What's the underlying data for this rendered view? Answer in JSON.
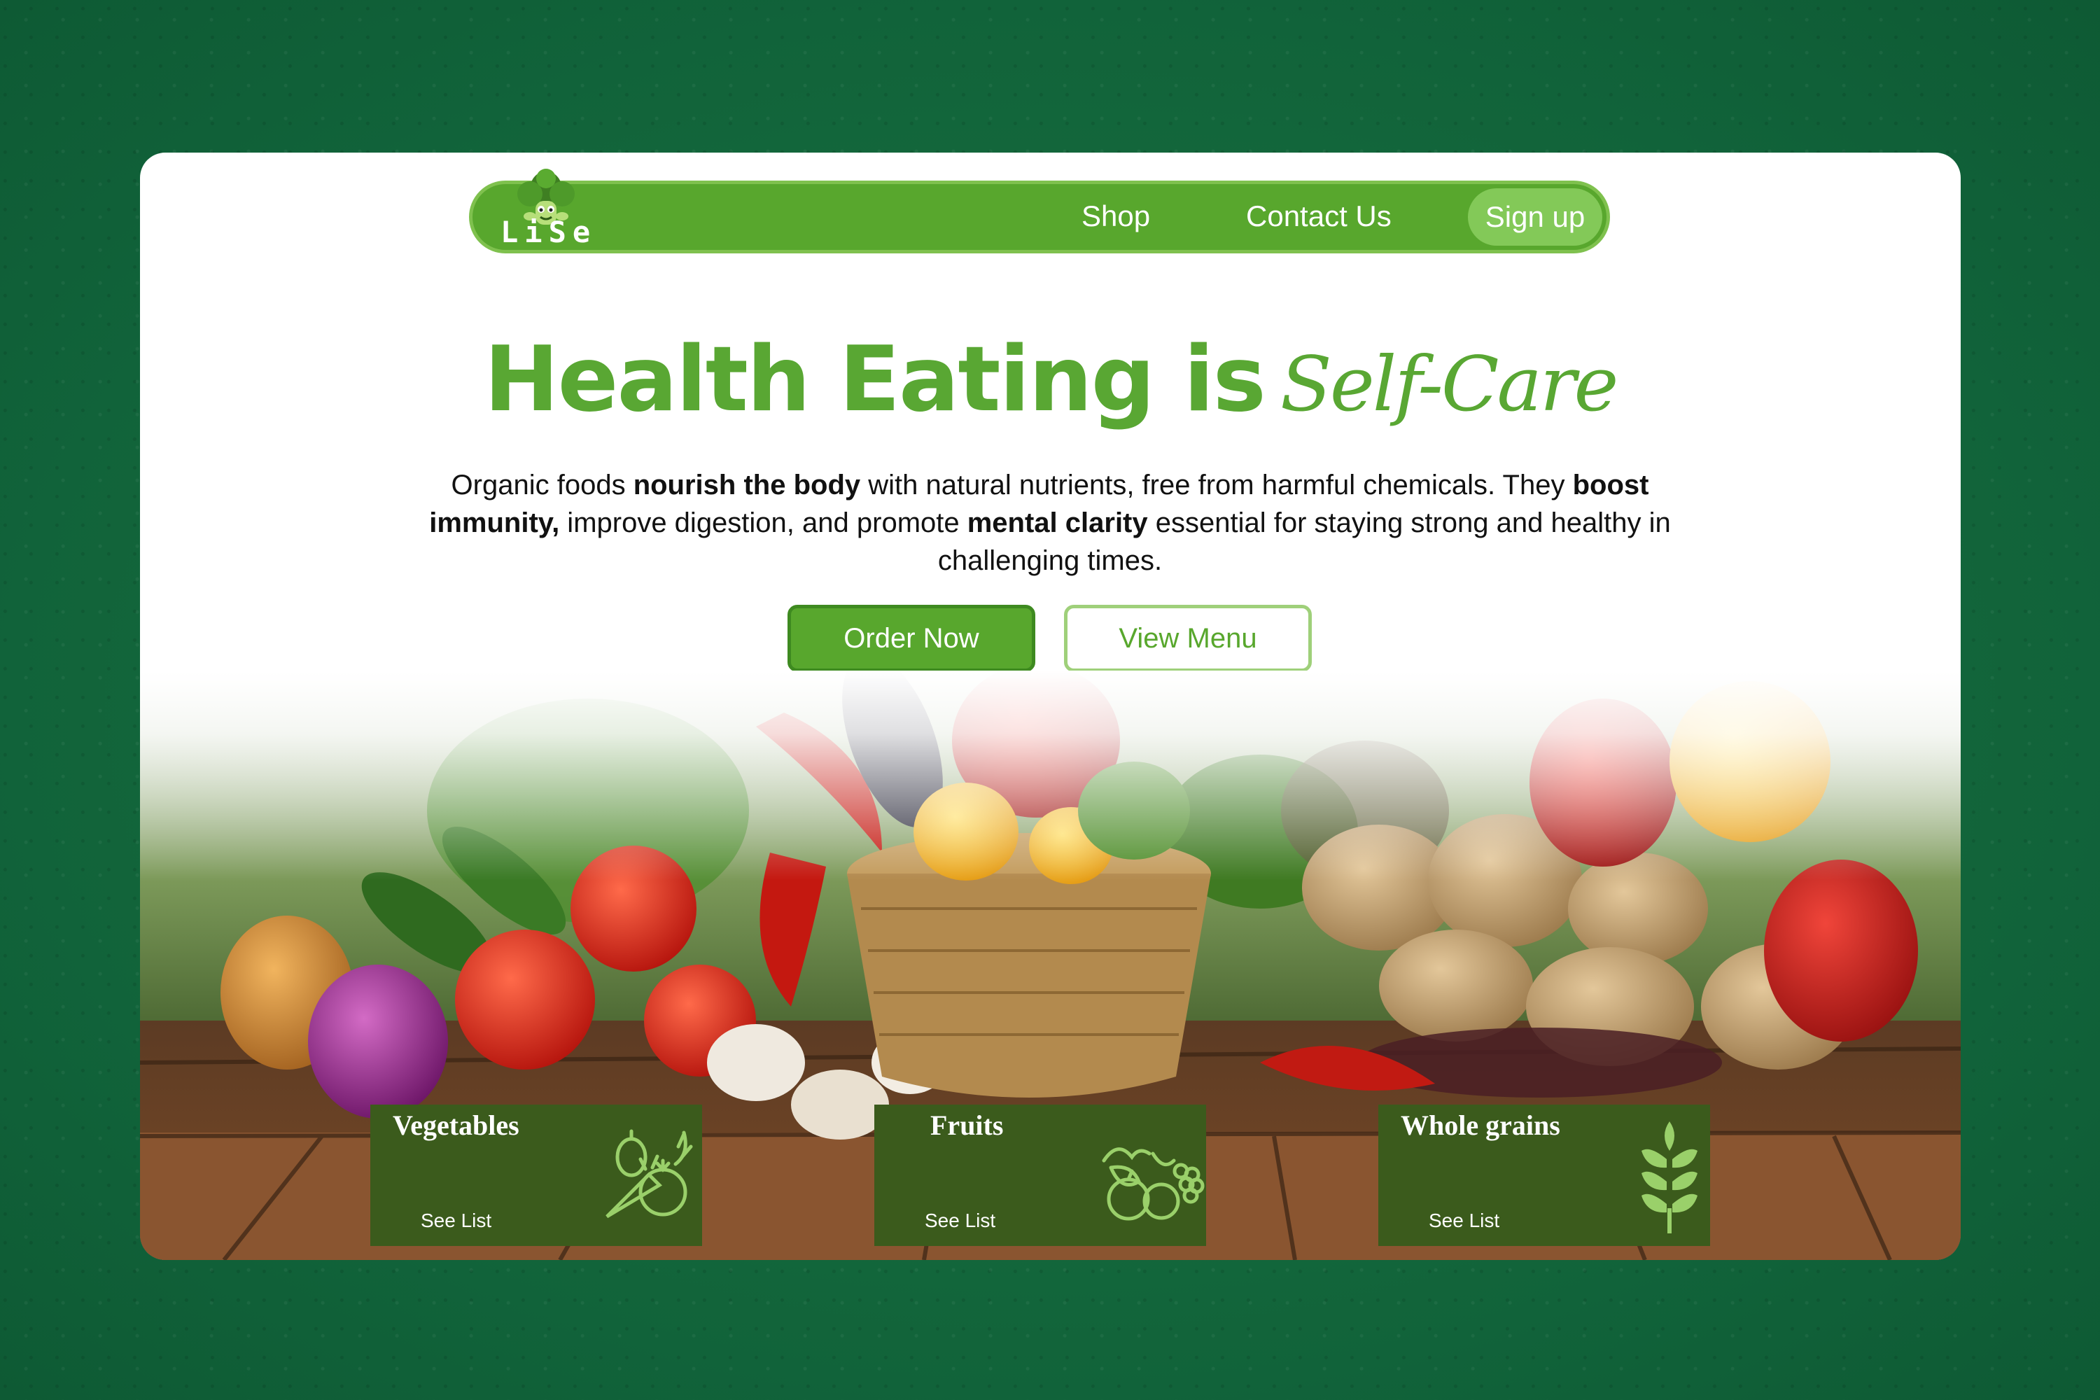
{
  "brand": {
    "name": "LiSe"
  },
  "nav": {
    "shop": "Shop",
    "contact": "Contact Us",
    "signup": "Sign up"
  },
  "hero": {
    "headline": "Health Eating is",
    "headline_script": "Self-Care",
    "para_1": "Organic foods ",
    "para_bold_1": "nourish the body",
    "para_2": " with natural nutrients, free from harmful chemicals. They ",
    "para_bold_2": "boost immunity,",
    "para_3": " improve digestion, and promote ",
    "para_bold_3": "mental clarity",
    "para_4": " essential for staying strong and healthy in challenging times.",
    "order_button": "Order Now",
    "menu_button": "View Menu"
  },
  "categories": [
    {
      "title": "Vegetables",
      "link": "See List",
      "icon": "vegetables-icon"
    },
    {
      "title": "Fruits",
      "link": "See List",
      "icon": "fruits-icon"
    },
    {
      "title": "Whole grains",
      "link": "See List",
      "icon": "wheat-icon"
    }
  ],
  "colors": {
    "background": "#146b3a",
    "brand_green": "#58a72d",
    "signup_pill": "#83c958",
    "category_card": "#3b5b1c",
    "icon_green": "#9ad06a"
  }
}
